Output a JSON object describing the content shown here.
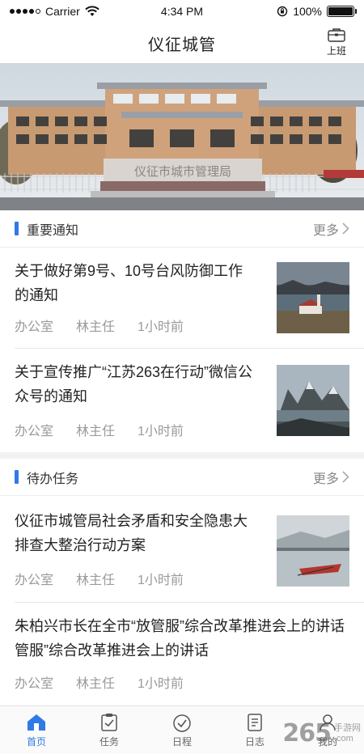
{
  "status": {
    "carrier": "Carrier",
    "time": "4:34 PM",
    "battery": "100%"
  },
  "nav": {
    "title": "仪征城管",
    "work_label": "上班"
  },
  "banner": {
    "sign_text": "仪征市城市管理局"
  },
  "notices": {
    "title": "重要通知",
    "more": "更多",
    "items": [
      {
        "title": "关于做好第9号、10号台风防御工作的通知",
        "dept": "办公室",
        "person": "林主任",
        "time": "1小时前",
        "thumb": "coast-church-icon"
      },
      {
        "title": "关于宣传推广“江苏263在行动”微信公众号的通知",
        "dept": "办公室",
        "person": "林主任",
        "time": "1小时前",
        "thumb": "fjord-mountain-icon"
      }
    ]
  },
  "tasks": {
    "title": "待办任务",
    "more": "更多",
    "items": [
      {
        "title": "仪征市城管局社会矛盾和安全隐患大排查大整治行动方案",
        "dept": "办公室",
        "person": "林主任",
        "time": "1小时前",
        "thumb": "lake-kayak-icon"
      },
      {
        "title": "朱柏兴市长在全市“放管服”综合改革推进会上的讲话管服”综合改革推进会上的讲话",
        "dept": "办公室",
        "person": "林主任",
        "time": "1小时前"
      }
    ]
  },
  "tabs": [
    {
      "label": "首页",
      "icon": "home-icon",
      "active": true
    },
    {
      "label": "任务",
      "icon": "task-icon",
      "active": false
    },
    {
      "label": "日程",
      "icon": "schedule-icon",
      "active": false
    },
    {
      "label": "日志",
      "icon": "log-icon",
      "active": false
    },
    {
      "label": "我的",
      "icon": "profile-icon",
      "active": false
    }
  ],
  "watermark": {
    "big": "265",
    "line1": "手游网",
    "line2": ".com"
  },
  "colors": {
    "accent": "#2f7ae5",
    "muted": "#9a9a9a"
  }
}
